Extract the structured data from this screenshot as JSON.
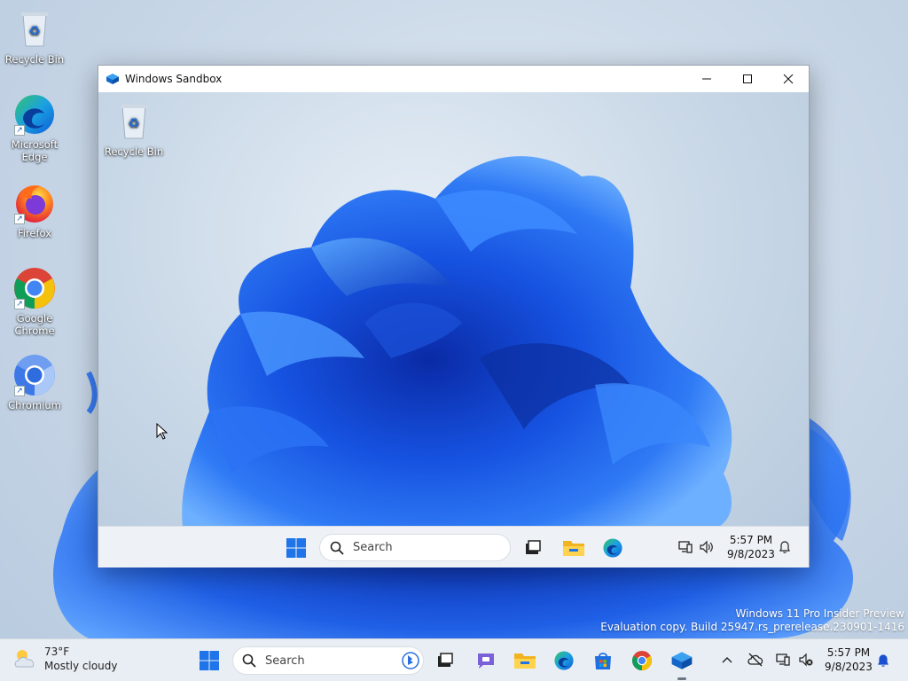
{
  "host": {
    "desktop_icons": [
      {
        "label": "Recycle Bin",
        "icon": "recycle-bin-icon"
      },
      {
        "label": "Microsoft Edge",
        "icon": "edge-icon"
      },
      {
        "label": "Firefox",
        "icon": "firefox-icon"
      },
      {
        "label": "Google Chrome",
        "icon": "chrome-icon"
      },
      {
        "label": "Chromium",
        "icon": "chromium-icon"
      }
    ],
    "watermark": {
      "line1": "Windows 11 Pro Insider Preview",
      "line2": "Evaluation copy. Build 25947.rs_prerelease.230901-1416"
    },
    "taskbar": {
      "weather_temp": "73°F",
      "weather_desc": "Mostly cloudy",
      "search_placeholder": "Search",
      "time": "5:57 PM",
      "date": "9/8/2023"
    }
  },
  "sandbox": {
    "title": "Windows Sandbox",
    "guest": {
      "desktop_icons": [
        {
          "label": "Recycle Bin",
          "icon": "recycle-bin-icon"
        }
      ],
      "taskbar": {
        "search_placeholder": "Search",
        "time": "5:57 PM",
        "date": "9/8/2023"
      }
    }
  },
  "colors": {
    "accent_blue": "#1e5ad8",
    "taskbar_bg": "#e9eef4"
  }
}
